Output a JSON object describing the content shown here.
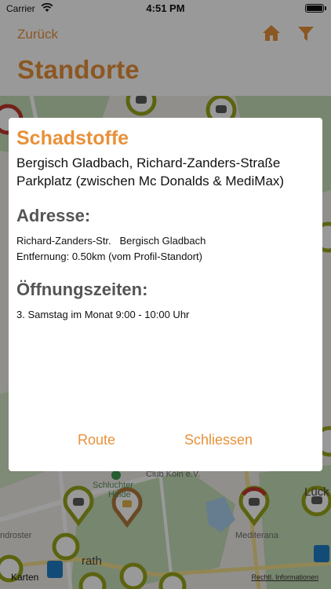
{
  "status_bar": {
    "carrier": "Carrier",
    "time": "4:51 PM"
  },
  "nav": {
    "back_label": "Zurück",
    "title": "Standorte"
  },
  "colors": {
    "accent": "#e8913a",
    "pin_olive": "#9aa61c",
    "pin_brown": "#b07a3c",
    "pin_blue": "#1f7ec8",
    "park_green": "#c7e0b8",
    "water_blue": "#a9d0ef",
    "road_yellow": "#f4df8e"
  },
  "icons": {
    "home": "home-icon",
    "filter": "filter-icon",
    "wifi": "wifi-icon",
    "battery": "battery-icon"
  },
  "map": {
    "labels": {
      "club": "Club Köln e.V.",
      "schluchter": "Schluchter",
      "heide": "Heide",
      "mediterana": "Mediterana",
      "droster": "ndroster",
      "rath": "rath",
      "lueck": "Lück"
    },
    "maps_logo": "Karten",
    "legal": "Rechtl. Informationen"
  },
  "dialog": {
    "title": "Schadstoffe",
    "location_line1": "Bergisch Gladbach, Richard-Zanders-Straße",
    "location_line2": "Parkplatz (zwischen Mc Donalds & MediMax)",
    "address_heading": "Adresse:",
    "address_street": "Richard-Zanders-Str.   Bergisch Gladbach",
    "distance": "Entfernung: 0.50km (vom Profil-Standort)",
    "hours_heading": "Öffnungszeiten:",
    "hours": "3. Samstag im Monat 9:00 - 10:00 Uhr",
    "route_label": "Route",
    "close_label": "Schliessen"
  }
}
